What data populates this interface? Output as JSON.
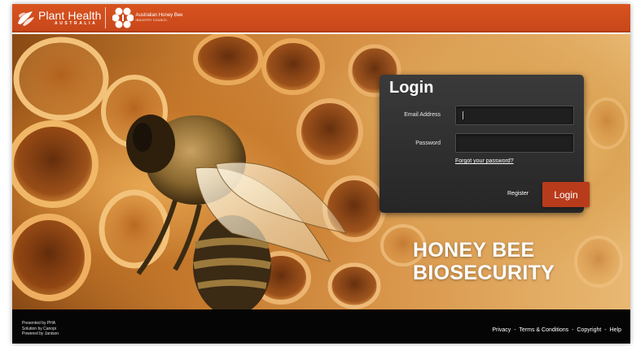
{
  "header": {
    "brand_primary": "Plant Health",
    "brand_primary_sub": "AUSTRALIA",
    "brand_secondary": "Australian Honey Bee",
    "brand_secondary_sub": "INDUSTRY COUNCIL",
    "bar_color": "#c8471a"
  },
  "hero": {
    "title_line1": "HONEY BEE",
    "title_line2": "BIOSECURITY"
  },
  "login": {
    "heading": "Login",
    "email_label": "Email Address",
    "email_value": "",
    "password_label": "Password",
    "password_value": "",
    "forgot_link": "Forgot your password?",
    "register_link": "Register",
    "submit_label": "Login",
    "accent_color": "#b83c1c",
    "panel_color": "#2e2e2e"
  },
  "footer": {
    "credit_1": "Presented by PHA",
    "credit_2": "Solution by Canopi",
    "credit_3": "Powered by Janison",
    "links": {
      "privacy": "Privacy",
      "terms": "Terms & Conditions",
      "copyright": "Copyright",
      "help": "Help"
    },
    "separator": "-"
  },
  "icons": {
    "pha_logo": "plant-health-leaf-icon",
    "ahbic_logo": "honeycomb-bee-icon"
  }
}
